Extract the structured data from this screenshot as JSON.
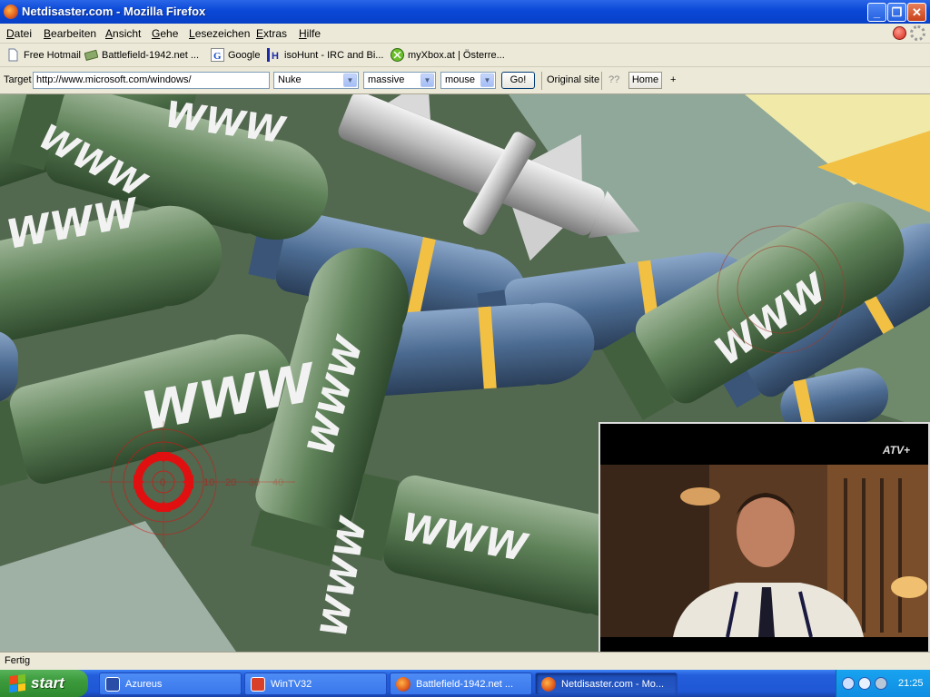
{
  "window": {
    "title": "Netdisaster.com - Mozilla Firefox",
    "minimize": "_",
    "restore": "❐",
    "close": "✕"
  },
  "menu": [
    "Datei",
    "Bearbeiten",
    "Ansicht",
    "Gehe",
    "Lesezeichen",
    "Extras",
    "Hilfe"
  ],
  "bookmarks": [
    {
      "label": "Free Hotmail",
      "icon": "page-icon"
    },
    {
      "label": "Battlefield-1942.net ...",
      "icon": "money-icon"
    },
    {
      "label": "Google",
      "icon": "google-icon"
    },
    {
      "label": "isoHunt - IRC and Bi...",
      "icon": "isohunt-icon"
    },
    {
      "label": "myXbox.at | Österre...",
      "icon": "xbox-icon"
    }
  ],
  "netdisaster": {
    "target_label": "Target",
    "url": "http://www.microsoft.com/windows/",
    "weapon": "Nuke",
    "intensity": "massive",
    "trigger": "mouse",
    "go": "Go!",
    "original_site": "Original site",
    "help": "??",
    "home": "Home",
    "plus": "+"
  },
  "crosshair": {
    "labels": [
      "0",
      "10",
      "20",
      "30",
      "40"
    ]
  },
  "bomb_text": "WWW",
  "tv": {
    "logo": "ATV+"
  },
  "status": "Fertig",
  "taskbar": {
    "start": "start",
    "tasks": [
      {
        "label": "Azureus",
        "icon": "azureus-icon",
        "active": false
      },
      {
        "label": "WinTV32",
        "icon": "wintv-icon",
        "active": false
      },
      {
        "label": "Battlefield-1942.net ...",
        "icon": "firefox-icon",
        "active": false
      },
      {
        "label": "Netdisaster.com - Mo...",
        "icon": "firefox-icon",
        "active": true
      }
    ],
    "clock": "21:25"
  },
  "colors": {
    "bomb_green": "#5b7c55",
    "bomb_blue": "#4b6a90",
    "stripe_yellow": "#f2c042",
    "crosshair_red": "#e01010",
    "xp_blue": "#0a48d6"
  }
}
